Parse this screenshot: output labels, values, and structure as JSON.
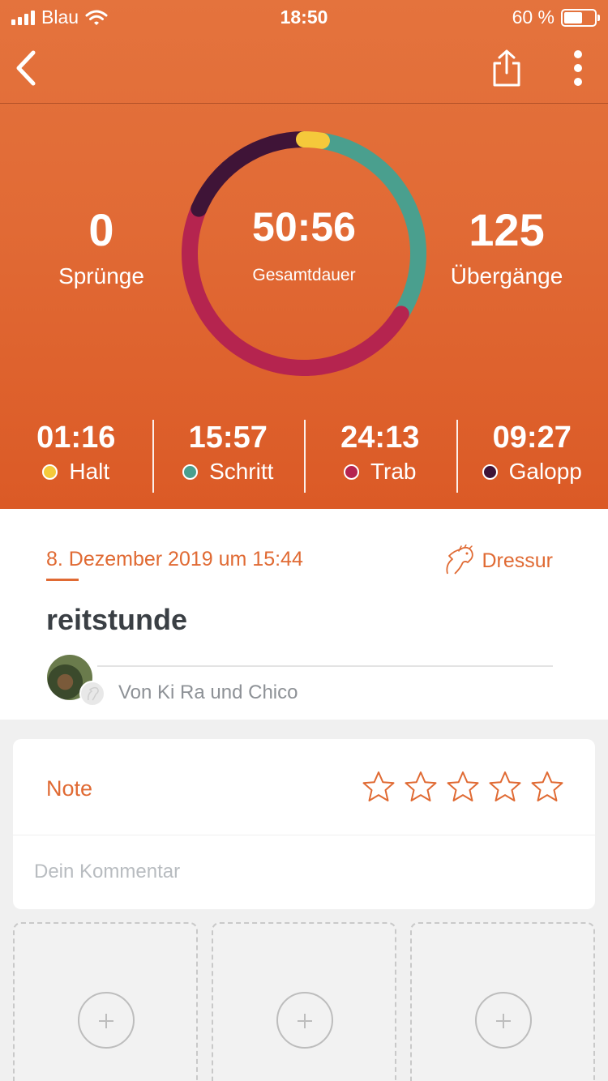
{
  "status_bar": {
    "carrier": "Blau",
    "time": "18:50",
    "battery": "60 %",
    "battery_level": 0.6
  },
  "nav": {
    "back_icon": "chevron-left-icon",
    "share_icon": "share-icon",
    "more_icon": "more-vertical-icon"
  },
  "summary": {
    "jumps_value": "0",
    "jumps_label": "Sprünge",
    "total_time": "50:56",
    "total_label": "Gesamtdauer",
    "transitions_value": "125",
    "transitions_label": "Übergänge"
  },
  "gaits": [
    {
      "time": "01:16",
      "name": "Halt",
      "color": "#f5c93b"
    },
    {
      "time": "15:57",
      "name": "Schritt",
      "color": "#4a9f8e"
    },
    {
      "time": "24:13",
      "name": "Trab",
      "color": "#b5244f"
    },
    {
      "time": "09:27",
      "name": "Galopp",
      "color": "#3f1437"
    }
  ],
  "ride": {
    "date": "8. Dezember 2019 um 15:44",
    "discipline": "Dressur",
    "discipline_icon": "horse-head-icon",
    "title": "reitstunde",
    "byline": "Von Ki Ra und Chico"
  },
  "rating": {
    "label": "Note",
    "stars": 0,
    "max_stars": 5,
    "comment_placeholder": "Dein Kommentar"
  },
  "photos": {
    "slots": 3,
    "add_icon": "plus-circle-icon"
  },
  "colors": {
    "accent": "#e06a33",
    "header_top": "#e4733d",
    "header_bottom": "#db5a26"
  }
}
